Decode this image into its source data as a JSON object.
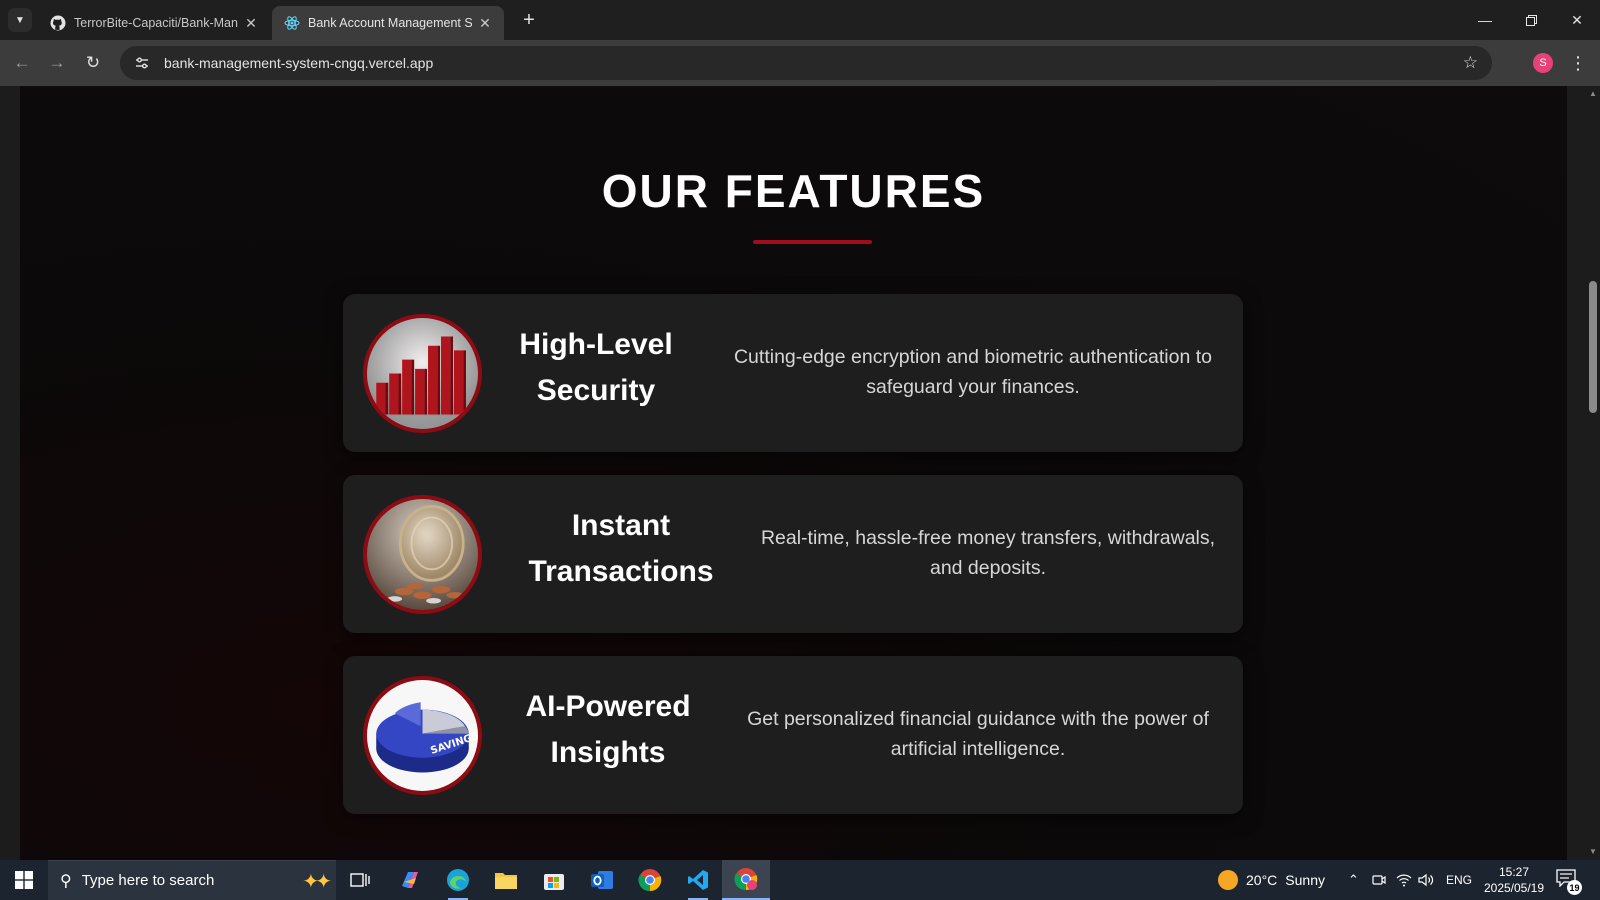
{
  "browser": {
    "tabs": [
      {
        "title": "TerrorBite-Capaciti/Bank-Manag",
        "icon": "github-icon",
        "active": false
      },
      {
        "title": "Bank Account Management Sys",
        "icon": "react-icon",
        "active": true
      }
    ],
    "new_tab_label": "+",
    "url": "bank-management-system-cngq.vercel.app",
    "profile_initial": "S"
  },
  "page": {
    "section_title": "OUR FEATURES",
    "accent_color": "#a10d1b",
    "features": [
      {
        "title_line1": "High-Level",
        "title_line2": "Security",
        "desc_line1": "Cutting-edge encryption and biometric authentication to",
        "desc_line2": "safeguard your finances.",
        "image": "red-bar-chart-image"
      },
      {
        "title_line1": "Instant",
        "title_line2": "Transactions",
        "desc_line1": "Real-time, hassle-free money transfers, withdrawals,",
        "desc_line2": "and deposits.",
        "image": "coins-jar-image"
      },
      {
        "title_line1": "AI-Powered",
        "title_line2": "Insights",
        "desc_line1": "Get personalized financial guidance with the power of",
        "desc_line2": "artificial intelligence.",
        "image": "savings-pie-chart-image"
      }
    ]
  },
  "taskbar": {
    "search_placeholder": "Type here to search",
    "weather_temp": "20°C",
    "weather_text": "Sunny",
    "language": "ENG",
    "time": "15:27",
    "date": "2025/05/19",
    "notification_count": "19",
    "apps": [
      "task-view-icon",
      "copilot-icon",
      "edge-icon",
      "file-explorer-icon",
      "microsoft-store-icon",
      "outlook-icon",
      "chrome-icon",
      "vscode-icon",
      "chrome-profile-icon"
    ]
  }
}
